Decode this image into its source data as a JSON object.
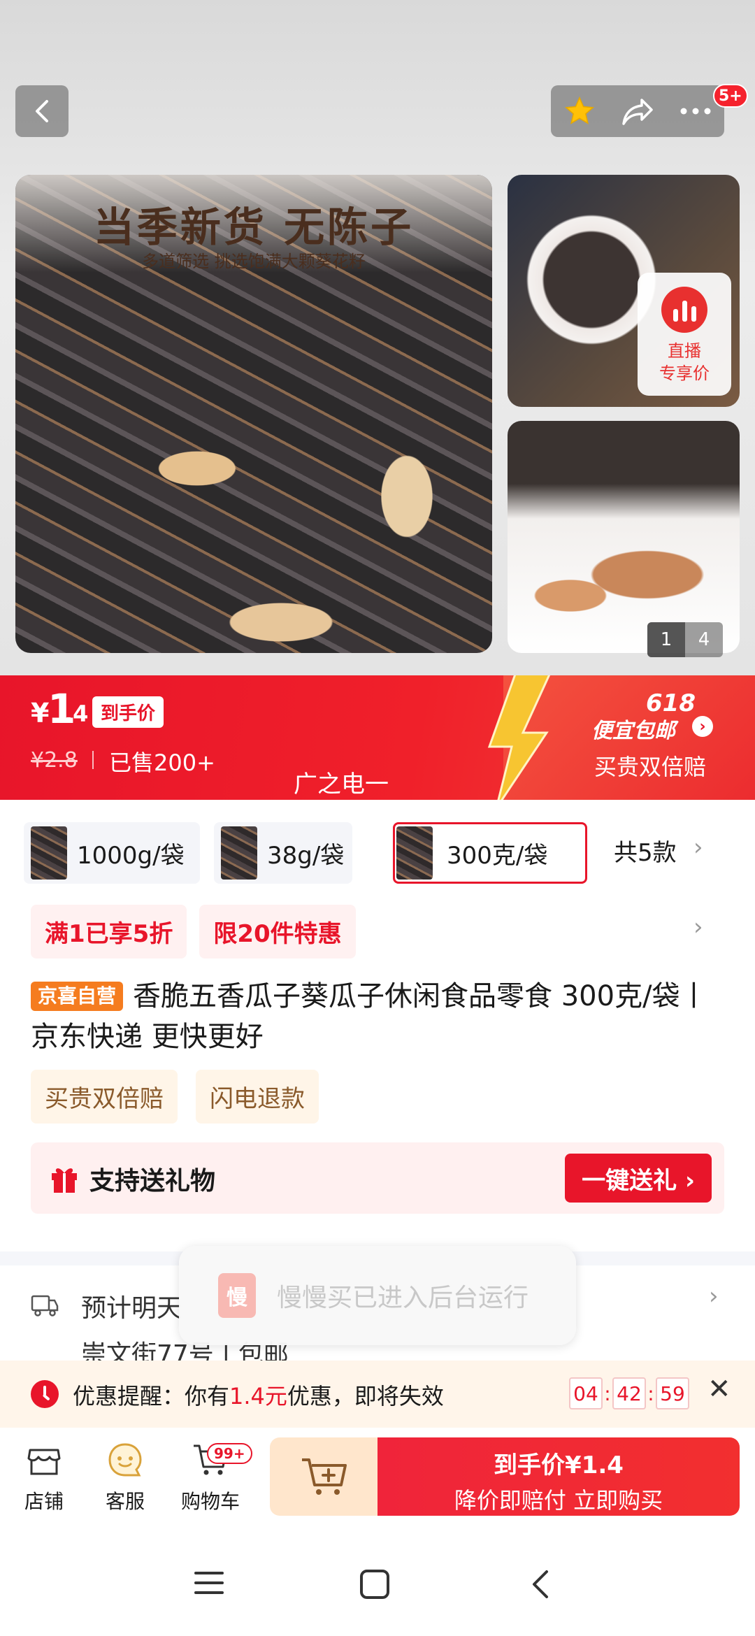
{
  "header": {
    "notification_badge": "5+"
  },
  "gallery": {
    "main_title": "当季新货 无陈子",
    "main_subtitle": "多道筛选 挑选饱满大颗葵花籽",
    "live_tag": {
      "line1": "直播",
      "line2": "专享价"
    },
    "page_current": "1",
    "page_total": "4"
  },
  "price_banner": {
    "currency": "¥",
    "price_int": "1",
    "price_dec": ".4",
    "price_tag": "到手价",
    "original_price": "¥2.8",
    "sold": "已售200+",
    "middle_text": "广之电一",
    "event": "618",
    "promo": "便宜包邮",
    "guarantee": "买贵双倍赔"
  },
  "variants": {
    "items": [
      {
        "label": "1000g/袋"
      },
      {
        "label": "38g/袋"
      },
      {
        "label": "300克/袋",
        "selected": true
      }
    ],
    "more_label": "共5款"
  },
  "promotions": [
    "满1已享5折",
    "限20件特惠"
  ],
  "product": {
    "store_tag": "京喜自营",
    "title": "香脆五香瓜子葵瓜子休闲食品零食 300克/袋丨京东快递 更快更好"
  },
  "services": [
    "买贵双倍赔",
    "闪电退款"
  ],
  "gift": {
    "label": "支持送礼物",
    "button": "一键送礼 ›"
  },
  "shipping": {
    "line1": "预计明天",
    "line2": "崇文街77号 | 包邮"
  },
  "toast": {
    "logo_char": "慢",
    "text": "慢慢买已进入后台运行"
  },
  "coupon_reminder": {
    "prefix": "优惠提醒：你有",
    "amount": "1.4元",
    "suffix": "优惠，即将失效",
    "timer": {
      "h": "04",
      "m": "42",
      "s": "59"
    }
  },
  "bottom_nav": {
    "store": "店铺",
    "service": "客服",
    "cart": "购物车",
    "cart_badge": "99+"
  },
  "buy_button": {
    "main": "到手价¥1.4",
    "sub": "降价即赔付 立即购买"
  },
  "colors": {
    "brand_red": "#e8152a",
    "orange_tag": "#f57c1f"
  }
}
